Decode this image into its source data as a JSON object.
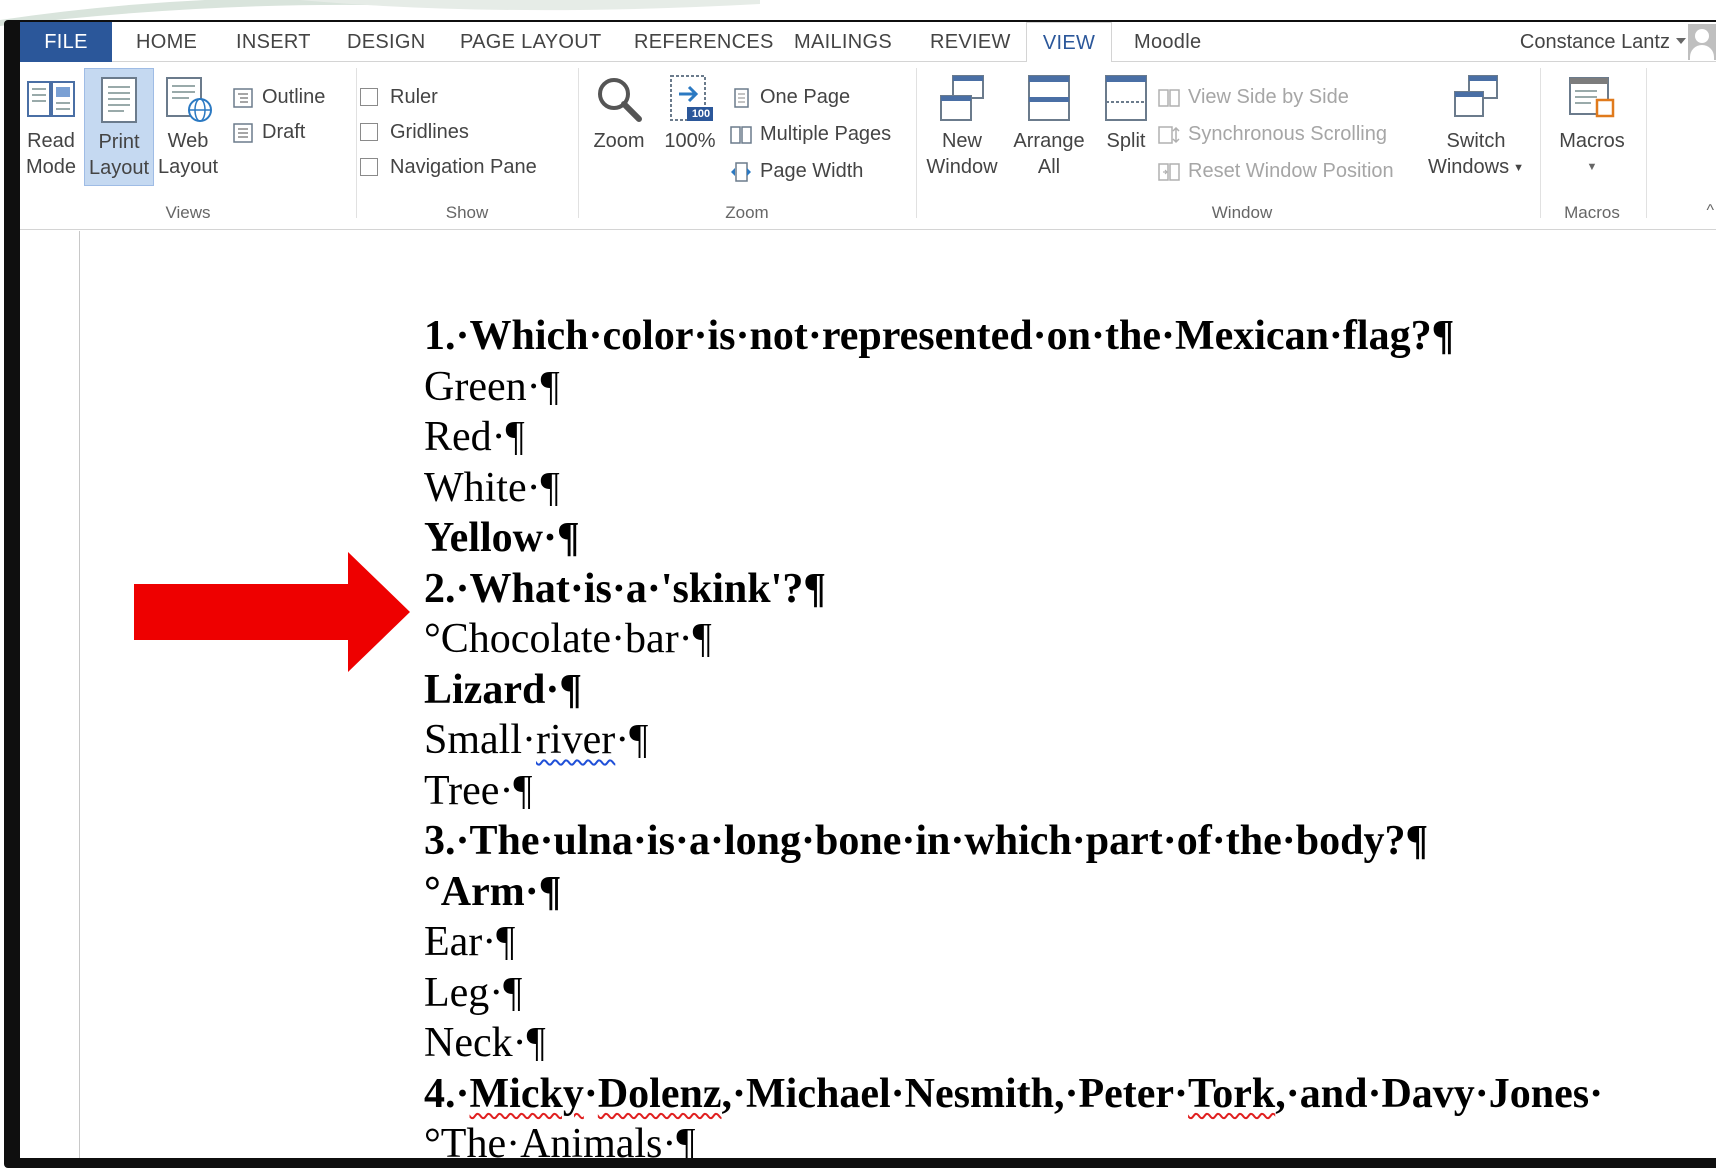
{
  "tabs": {
    "file": "FILE",
    "items": [
      "HOME",
      "INSERT",
      "DESIGN",
      "PAGE LAYOUT",
      "REFERENCES",
      "MAILINGS",
      "REVIEW",
      "VIEW",
      "Moodle"
    ],
    "active": "VIEW"
  },
  "user": {
    "name": "Constance Lantz"
  },
  "ribbon": {
    "views": {
      "label": "Views",
      "read_mode": "Read Mode",
      "read_mode_l1": "Read",
      "read_mode_l2": "Mode",
      "print_layout_l1": "Print",
      "print_layout_l2": "Layout",
      "web_layout_l1": "Web",
      "web_layout_l2": "Layout",
      "outline": "Outline",
      "draft": "Draft"
    },
    "show": {
      "label": "Show",
      "ruler": "Ruler",
      "gridlines": "Gridlines",
      "navigation_pane": "Navigation Pane"
    },
    "zoom": {
      "label": "Zoom",
      "zoom": "Zoom",
      "hundred": "100%",
      "badge": "100",
      "one_page": "One Page",
      "multiple_pages": "Multiple Pages",
      "page_width": "Page Width"
    },
    "window": {
      "label": "Window",
      "new_window_l1": "New",
      "new_window_l2": "Window",
      "arrange_all_l1": "Arrange",
      "arrange_all_l2": "All",
      "split": "Split",
      "view_side_by_side": "View Side by Side",
      "synchronous_scrolling": "Synchronous Scrolling",
      "reset_window_position": "Reset Window Position",
      "switch_windows_l1": "Switch",
      "switch_windows_l2": "Windows"
    },
    "macros": {
      "label": "Macros",
      "macros": "Macros"
    }
  },
  "document": {
    "lines": [
      "1.·Which·color·is·not·represented·on·the·Mexican·flag?¶",
      "Green·¶",
      "Red·¶",
      "White·¶",
      "Yellow·¶",
      "2.·What·is·a·'skink'?¶",
      "°Chocolate·bar·¶",
      "Lizard·¶",
      "Small·",
      "river",
      "·¶",
      "Tree·¶",
      "3.·The·ulna·is·a·long·bone·in·which·part·of·the·body?¶",
      "°Arm·¶",
      "Ear·¶",
      "Leg·¶",
      "Neck·¶",
      "4.·",
      "Micky",
      "·",
      "Dolenz",
      ",·Michael·Nesmith,·Peter·",
      "Tork",
      ",·and·Davy·Jones·",
      "°The·Animals·¶"
    ]
  },
  "colors": {
    "accent": "#2b579a",
    "arrow": "#ee0000",
    "selected_button": "#c5d9f1"
  }
}
